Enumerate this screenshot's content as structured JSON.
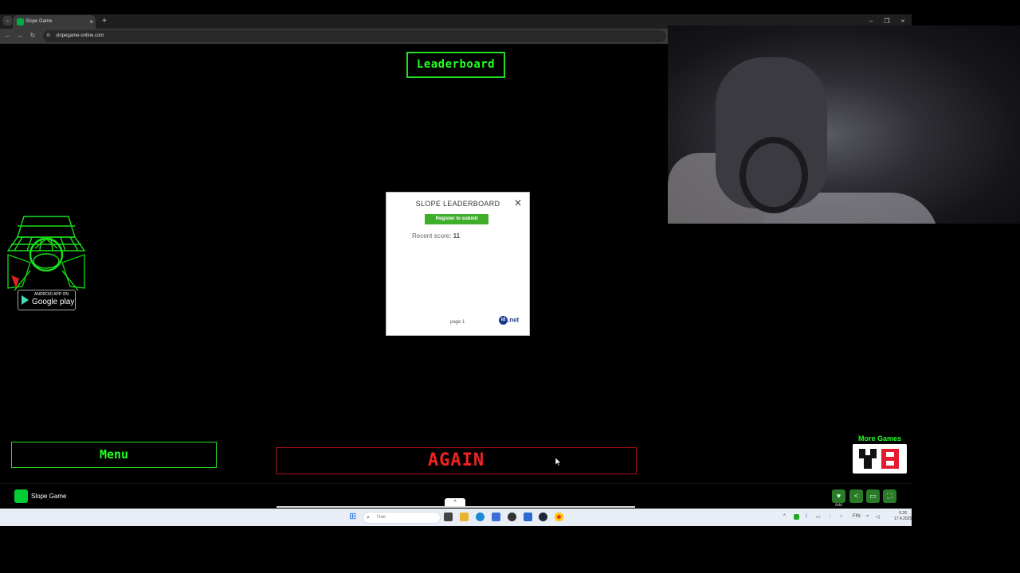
{
  "browser": {
    "tab_title": "Slope Game",
    "tab_close": "×",
    "new_tab": "+",
    "tab_menu": "⌄",
    "url": "slopegame-online.com",
    "nav": {
      "back": "←",
      "forward": "→",
      "reload": "↻"
    },
    "window": {
      "minimize": "–",
      "restore": "❐",
      "close": "×"
    }
  },
  "game": {
    "leaderboard_button": "Leaderboard",
    "menu_button": "Menu",
    "again_button": "AGAIN",
    "more_games_label": "More Games",
    "android_top": "ANDROID APP ON",
    "android_bottom": "Google play"
  },
  "modal": {
    "title": "SLOPE LEADERBOARD",
    "close": "✕",
    "register_button": "Register to submit",
    "recent_score_label": "Recent score:",
    "recent_score_value": "11",
    "page_label": "page 1",
    "brand_circle": "id",
    "brand_suffix": ".net"
  },
  "gamebar": {
    "title": "Slope Game",
    "add_label": "Add",
    "buttons": {
      "like": "♥",
      "share": "<",
      "window": "▭",
      "fullscreen": "⛶"
    },
    "collapse": "^"
  },
  "taskbar": {
    "search_placeholder": "Hae",
    "tray_lang": "FIN",
    "clock_time": "0.26",
    "clock_date": "17.4.2025"
  },
  "colors": {
    "neon_green": "#22ff22",
    "again_red": "#ee2222",
    "register_green": "#3fae2a"
  }
}
